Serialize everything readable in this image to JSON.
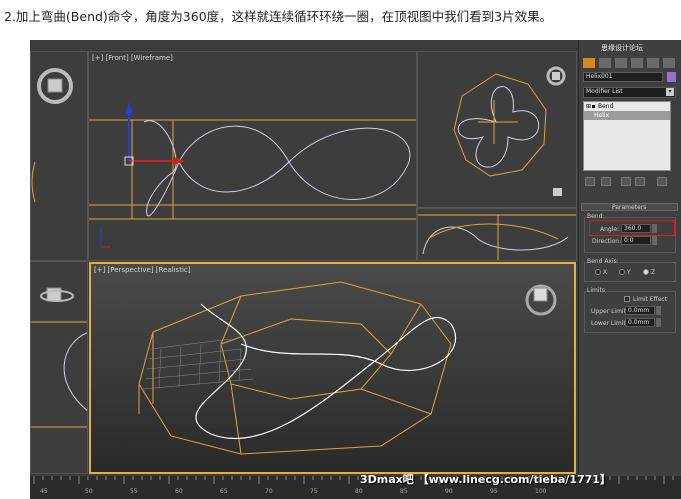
{
  "caption": "2.加上弯曲(Bend)命令，角度为360度，这样就连续循环环绕一圈，在顶视图中我们看到3片效果。",
  "viewports": {
    "front_label": "[+] [Front] [Wireframe]",
    "persp_label": "[+] [Perspective] [Realistic]"
  },
  "panel": {
    "brand": "思缘设计论坛",
    "object_name": "Helix001",
    "modifier_list": "Modifier List",
    "stack": [
      "Bend",
      "Helix"
    ],
    "params_title": "Parameters",
    "bend_group": "Bend:",
    "angle_label": "Angle:",
    "angle_value": "360.0",
    "direction_label": "Direction:",
    "direction_value": "0.0",
    "axis_group": "Bend Axis:",
    "axis_x": "X",
    "axis_y": "Y",
    "axis_z": "Z",
    "limits_group": "Limits",
    "limit_effect": "Limit Effect",
    "upper_label": "Upper Limit:",
    "upper_value": "0.0mm",
    "lower_label": "Lower Limit:",
    "lower_value": "0.0mm"
  },
  "ruler": {
    "ticks": [
      "45",
      "50",
      "55",
      "60",
      "65",
      "70",
      "75",
      "80",
      "85",
      "90",
      "95",
      "100"
    ]
  },
  "watermark": "3Dmax吧 【www.linecg.com/tieba/1771】",
  "colors": {
    "spline": "#d8cce8",
    "orange": "#e2a23c",
    "highlight": "#cc2222"
  }
}
